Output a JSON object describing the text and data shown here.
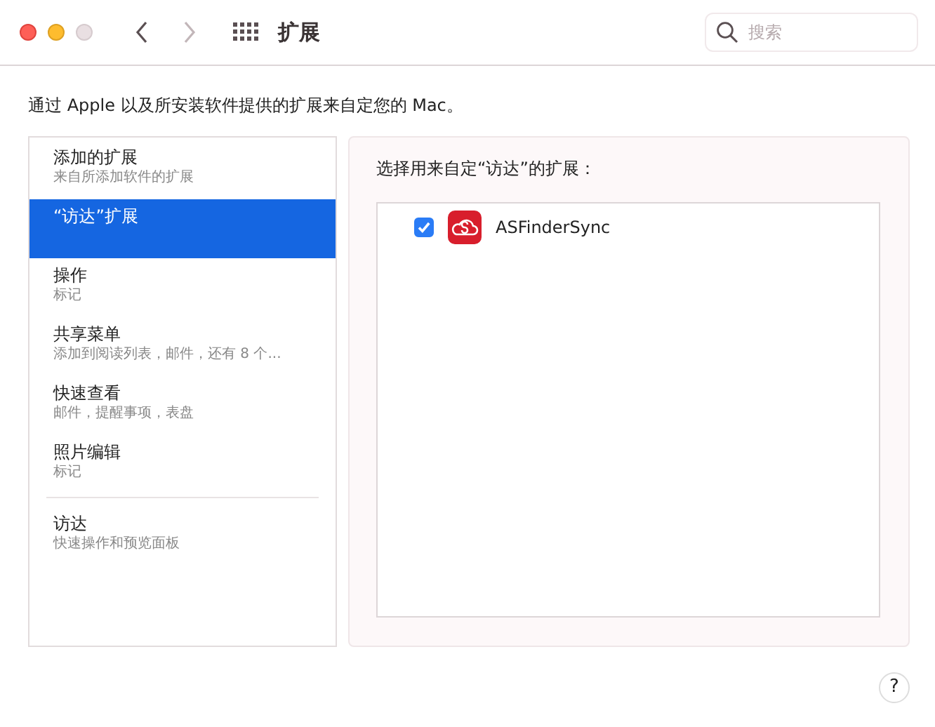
{
  "toolbar": {
    "title": "扩展",
    "search": {
      "placeholder": "搜索"
    }
  },
  "description": "通过 Apple 以及所安装软件提供的扩展来自定您的 Mac。",
  "sidebar": {
    "sections": [
      {
        "items": [
          {
            "title": "添加的扩展",
            "subtitle": "来自所添加软件的扩展",
            "selected": false
          },
          {
            "title": "“访达”扩展",
            "selected": true
          },
          {
            "title": "操作",
            "subtitle": "标记",
            "selected": false
          },
          {
            "title": "共享菜单",
            "subtitle": "添加到阅读列表，邮件，还有 8 个...",
            "selected": false
          },
          {
            "title": "快速查看",
            "subtitle": "邮件，提醒事项，表盘",
            "selected": false
          },
          {
            "title": "照片编辑",
            "subtitle": "标记",
            "selected": false
          }
        ]
      },
      {
        "items": [
          {
            "title": "访达",
            "subtitle": "快速操作和预览面板",
            "selected": false
          }
        ]
      }
    ]
  },
  "detail": {
    "heading": "选择用来自定“访达”的扩展：",
    "extensions": [
      {
        "name": "ASFinderSync",
        "checked": true
      }
    ]
  },
  "help_button": "?"
}
